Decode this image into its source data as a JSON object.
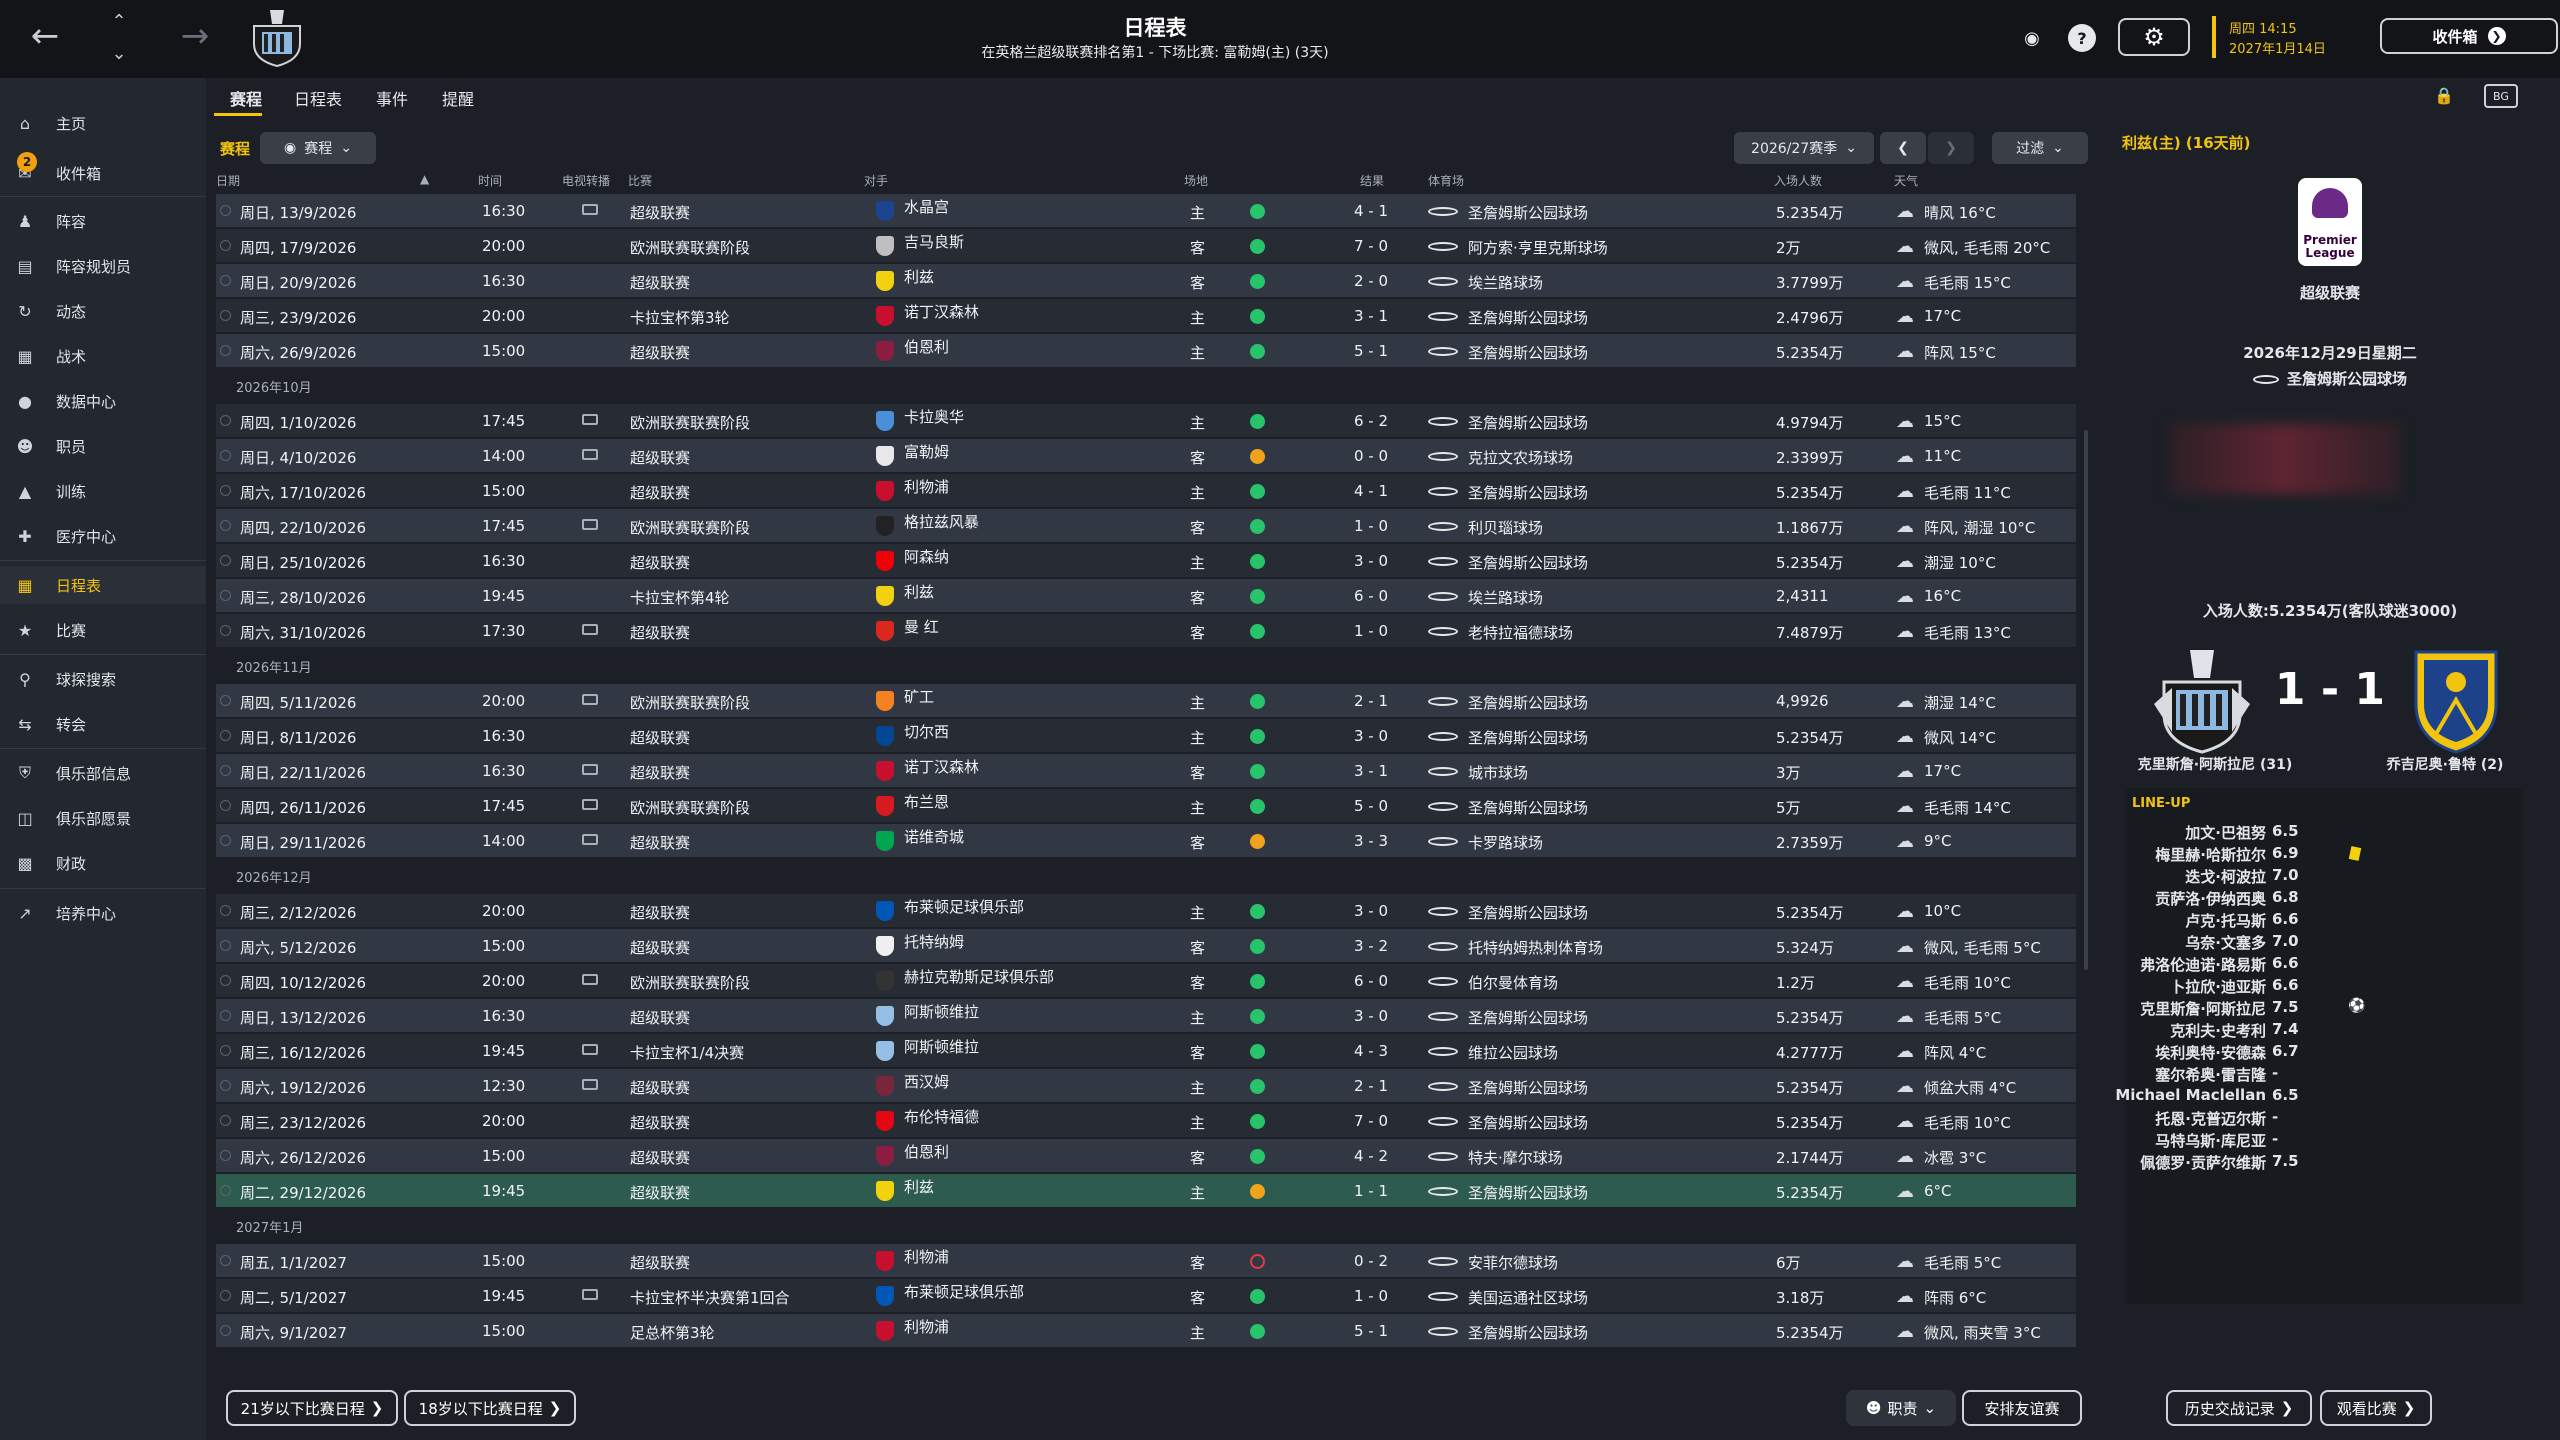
{
  "header": {
    "title": "日程表",
    "subtitle": "在英格兰超级联赛排名第1 - 下场比赛: 富勒姆(主) (3天)",
    "date_line1": "周四 14:15",
    "date_line2": "2027年1月14日",
    "inbox_label": "收件箱"
  },
  "sidebar": {
    "items": [
      {
        "label": "主页",
        "icon": "home-icon"
      },
      {
        "label": "收件箱",
        "icon": "inbox-icon",
        "badge": "2"
      },
      {
        "label": "阵容",
        "icon": "squad-icon"
      },
      {
        "label": "阵容规划员",
        "icon": "planner-icon"
      },
      {
        "label": "动态",
        "icon": "dynamics-icon"
      },
      {
        "label": "战术",
        "icon": "tactics-icon"
      },
      {
        "label": "数据中心",
        "icon": "data-hub-icon"
      },
      {
        "label": "职员",
        "icon": "staff-icon"
      },
      {
        "label": "训练",
        "icon": "training-icon"
      },
      {
        "label": "医疗中心",
        "icon": "medical-icon"
      },
      {
        "label": "日程表",
        "icon": "calendar-icon",
        "active": true
      },
      {
        "label": "比赛",
        "icon": "trophy-icon"
      },
      {
        "label": "球探搜索",
        "icon": "scouting-icon"
      },
      {
        "label": "转会",
        "icon": "transfers-icon"
      },
      {
        "label": "俱乐部信息",
        "icon": "club-info-icon"
      },
      {
        "label": "俱乐部愿景",
        "icon": "club-vision-icon"
      },
      {
        "label": "财政",
        "icon": "finances-icon"
      },
      {
        "label": "培养中心",
        "icon": "development-icon"
      }
    ]
  },
  "subtabs": [
    "赛程",
    "日程表",
    "事件",
    "提醒"
  ],
  "filter": {
    "label": "赛程",
    "view_label": "赛程",
    "season": "2026/27赛季",
    "filter_label": "过滤"
  },
  "columns": {
    "date": "日期",
    "time": "时间",
    "tv": "电视转播",
    "competition": "比赛",
    "opponent": "对手",
    "venue": "场地",
    "result": "结果",
    "stadium": "体育场",
    "attendance": "入场人数",
    "weather": "天气"
  },
  "rows": [
    {
      "date": "周日, 13/9/2026",
      "time": "16:30",
      "tv": true,
      "comp": "超级联赛",
      "opp": "水晶宫",
      "opp_color": "#1b458f",
      "venue": "主",
      "res": "win",
      "score": "4 - 1",
      "stadium": "圣詹姆斯公园球场",
      "att": "5.2354万",
      "weather": "晴风 16°C"
    },
    {
      "date": "周四, 17/9/2026",
      "time": "20:00",
      "tv": false,
      "comp": "欧洲联赛联赛阶段",
      "opp": "吉马良斯",
      "opp_color": "#bfbfbf",
      "venue": "客",
      "res": "win",
      "score": "7 - 0",
      "stadium": "阿方索·亨里克斯球场",
      "att": "2万",
      "weather": "微风, 毛毛雨 20°C"
    },
    {
      "date": "周日, 20/9/2026",
      "time": "16:30",
      "tv": false,
      "comp": "超级联赛",
      "opp": "利兹",
      "opp_color": "#f2d20e",
      "venue": "客",
      "res": "win",
      "score": "2 - 0",
      "stadium": "埃兰路球场",
      "att": "3.7799万",
      "weather": "毛毛雨 15°C"
    },
    {
      "date": "周三, 23/9/2026",
      "time": "20:00",
      "tv": false,
      "comp": "卡拉宝杯第3轮",
      "opp": "诺丁汉森林",
      "opp_color": "#c8102e",
      "venue": "主",
      "res": "win",
      "score": "3 - 1",
      "stadium": "圣詹姆斯公园球场",
      "att": "2.4796万",
      "weather": "17°C"
    },
    {
      "date": "周六, 26/9/2026",
      "time": "15:00",
      "tv": false,
      "comp": "超级联赛",
      "opp": "伯恩利",
      "opp_color": "#8c1d40",
      "venue": "主",
      "res": "win",
      "score": "5 - 1",
      "stadium": "圣詹姆斯公园球场",
      "att": "5.2354万",
      "weather": "阵风 15°C"
    },
    {
      "month": "2026年10月"
    },
    {
      "date": "周四, 1/10/2026",
      "time": "17:45",
      "tv": true,
      "comp": "欧洲联赛联赛阶段",
      "opp": "卡拉奥华",
      "opp_color": "#4a90d9",
      "venue": "主",
      "res": "win",
      "score": "6 - 2",
      "stadium": "圣詹姆斯公园球场",
      "att": "4.9794万",
      "weather": "15°C"
    },
    {
      "date": "周日, 4/10/2026",
      "time": "14:00",
      "tv": true,
      "comp": "超级联赛",
      "opp": "富勒姆",
      "opp_color": "#e8e8e8",
      "venue": "客",
      "res": "draw",
      "score": "0 - 0",
      "stadium": "克拉文农场球场",
      "att": "2.3399万",
      "weather": "11°C"
    },
    {
      "date": "周六, 17/10/2026",
      "time": "15:00",
      "tv": false,
      "comp": "超级联赛",
      "opp": "利物浦",
      "opp_color": "#c8102e",
      "venue": "主",
      "res": "win",
      "score": "4 - 1",
      "stadium": "圣詹姆斯公园球场",
      "att": "5.2354万",
      "weather": "毛毛雨 11°C"
    },
    {
      "date": "周四, 22/10/2026",
      "time": "17:45",
      "tv": true,
      "comp": "欧洲联赛联赛阶段",
      "opp": "格拉兹风暴",
      "opp_color": "#222222",
      "venue": "客",
      "res": "win",
      "score": "1 - 0",
      "stadium": "利贝瑙球场",
      "att": "1.1867万",
      "weather": "阵风, 潮湿 10°C"
    },
    {
      "date": "周日, 25/10/2026",
      "time": "16:30",
      "tv": false,
      "comp": "超级联赛",
      "opp": "阿森纳",
      "opp_color": "#ef0107",
      "venue": "主",
      "res": "win",
      "score": "3 - 0",
      "stadium": "圣詹姆斯公园球场",
      "att": "5.2354万",
      "weather": "潮湿 10°C"
    },
    {
      "date": "周三, 28/10/2026",
      "time": "19:45",
      "tv": false,
      "comp": "卡拉宝杯第4轮",
      "opp": "利兹",
      "opp_color": "#f2d20e",
      "venue": "客",
      "res": "win",
      "score": "6 - 0",
      "stadium": "埃兰路球场",
      "att": "2,4311",
      "weather": "16°C"
    },
    {
      "date": "周六, 31/10/2026",
      "time": "17:30",
      "tv": true,
      "comp": "超级联赛",
      "opp": "曼 红",
      "opp_color": "#da291c",
      "venue": "客",
      "res": "win",
      "score": "1 - 0",
      "stadium": "老特拉福德球场",
      "att": "7.4879万",
      "weather": "毛毛雨 13°C"
    },
    {
      "month": "2026年11月"
    },
    {
      "date": "周四, 5/11/2026",
      "time": "20:00",
      "tv": true,
      "comp": "欧洲联赛联赛阶段",
      "opp": "矿工",
      "opp_color": "#f58220",
      "venue": "主",
      "res": "win",
      "score": "2 - 1",
      "stadium": "圣詹姆斯公园球场",
      "att": "4,9926",
      "weather": "潮湿 14°C"
    },
    {
      "date": "周日, 8/11/2026",
      "time": "16:30",
      "tv": false,
      "comp": "超级联赛",
      "opp": "切尔西",
      "opp_color": "#034694",
      "venue": "主",
      "res": "win",
      "score": "3 - 0",
      "stadium": "圣詹姆斯公园球场",
      "att": "5.2354万",
      "weather": "微风 14°C"
    },
    {
      "date": "周日, 22/11/2026",
      "time": "16:30",
      "tv": true,
      "comp": "超级联赛",
      "opp": "诺丁汉森林",
      "opp_color": "#c8102e",
      "venue": "客",
      "res": "win",
      "score": "3 - 1",
      "stadium": "城市球场",
      "att": "3万",
      "weather": "17°C"
    },
    {
      "date": "周四, 26/11/2026",
      "time": "17:45",
      "tv": true,
      "comp": "欧洲联赛联赛阶段",
      "opp": "布兰恩",
      "opp_color": "#d71920",
      "venue": "主",
      "res": "win",
      "score": "5 - 0",
      "stadium": "圣詹姆斯公园球场",
      "att": "5万",
      "weather": "毛毛雨 14°C"
    },
    {
      "date": "周日, 29/11/2026",
      "time": "14:00",
      "tv": true,
      "comp": "超级联赛",
      "opp": "诺维奇城",
      "opp_color": "#00a650",
      "venue": "客",
      "res": "draw",
      "score": "3 - 3",
      "stadium": "卡罗路球场",
      "att": "2.7359万",
      "weather": "9°C"
    },
    {
      "month": "2026年12月"
    },
    {
      "date": "周三, 2/12/2026",
      "time": "20:00",
      "tv": false,
      "comp": "超级联赛",
      "opp": "布莱顿足球俱乐部",
      "opp_color": "#0057b8",
      "venue": "主",
      "res": "win",
      "score": "3 - 0",
      "stadium": "圣詹姆斯公园球场",
      "att": "5.2354万",
      "weather": "10°C"
    },
    {
      "date": "周六, 5/12/2026",
      "time": "15:00",
      "tv": false,
      "comp": "超级联赛",
      "opp": "托特纳姆",
      "opp_color": "#f0f0f0",
      "venue": "客",
      "res": "win",
      "score": "3 - 2",
      "stadium": "托特纳姆热刺体育场",
      "att": "5.324万",
      "weather": "微风, 毛毛雨 5°C"
    },
    {
      "date": "周四, 10/12/2026",
      "time": "20:00",
      "tv": true,
      "comp": "欧洲联赛联赛阶段",
      "opp": "赫拉克勒斯足球俱乐部",
      "opp_color": "#333333",
      "venue": "客",
      "res": "win",
      "score": "6 - 0",
      "stadium": "伯尔曼体育场",
      "att": "1.2万",
      "weather": "毛毛雨 10°C"
    },
    {
      "date": "周日, 13/12/2026",
      "time": "16:30",
      "tv": false,
      "comp": "超级联赛",
      "opp": "阿斯顿维拉",
      "opp_color": "#95bfe5",
      "venue": "主",
      "res": "win",
      "score": "3 - 0",
      "stadium": "圣詹姆斯公园球场",
      "att": "5.2354万",
      "weather": "毛毛雨 5°C"
    },
    {
      "date": "周三, 16/12/2026",
      "time": "19:45",
      "tv": true,
      "comp": "卡拉宝杯1/4决赛",
      "opp": "阿斯顿维拉",
      "opp_color": "#95bfe5",
      "venue": "客",
      "res": "win",
      "score": "4 - 3",
      "stadium": "维拉公园球场",
      "att": "4.2777万",
      "weather": "阵风 4°C"
    },
    {
      "date": "周六, 19/12/2026",
      "time": "12:30",
      "tv": true,
      "comp": "超级联赛",
      "opp": "西汉姆",
      "opp_color": "#7a263a",
      "venue": "主",
      "res": "win",
      "score": "2 - 1",
      "stadium": "圣詹姆斯公园球场",
      "att": "5.2354万",
      "weather": "倾盆大雨 4°C"
    },
    {
      "date": "周三, 23/12/2026",
      "time": "20:00",
      "tv": false,
      "comp": "超级联赛",
      "opp": "布伦特福德",
      "opp_color": "#e30613",
      "venue": "主",
      "res": "win",
      "score": "7 - 0",
      "stadium": "圣詹姆斯公园球场",
      "att": "5.2354万",
      "weather": "毛毛雨 10°C"
    },
    {
      "date": "周六, 26/12/2026",
      "time": "15:00",
      "tv": false,
      "comp": "超级联赛",
      "opp": "伯恩利",
      "opp_color": "#8c1d40",
      "venue": "客",
      "res": "win",
      "score": "4 - 2",
      "stadium": "特夫·摩尔球场",
      "att": "2.1744万",
      "weather": "冰雹 3°C"
    },
    {
      "date": "周二, 29/12/2026",
      "time": "19:45",
      "tv": false,
      "comp": "超级联赛",
      "opp": "利兹",
      "opp_color": "#f2d20e",
      "venue": "主",
      "res": "draw",
      "score": "1 - 1",
      "stadium": "圣詹姆斯公园球场",
      "att": "5.2354万",
      "weather": "6°C",
      "selected": true
    },
    {
      "month": "2027年1月"
    },
    {
      "date": "周五, 1/1/2027",
      "time": "15:00",
      "tv": false,
      "comp": "超级联赛",
      "opp": "利物浦",
      "opp_color": "#c8102e",
      "venue": "客",
      "res": "loss",
      "score": "0 - 2",
      "stadium": "安菲尔德球场",
      "att": "6万",
      "weather": "毛毛雨 5°C"
    },
    {
      "date": "周二, 5/1/2027",
      "time": "19:45",
      "tv": true,
      "comp": "卡拉宝杯半决赛第1回合",
      "opp": "布莱顿足球俱乐部",
      "opp_color": "#0057b8",
      "venue": "客",
      "res": "win",
      "score": "1 - 0",
      "stadium": "美国运通社区球场",
      "att": "3.18万",
      "weather": "阵雨 6°C"
    },
    {
      "date": "周六, 9/1/2027",
      "time": "15:00",
      "tv": false,
      "comp": "足总杯第3轮",
      "opp": "利物浦",
      "opp_color": "#c8102e",
      "venue": "主",
      "res": "win",
      "score": "5 - 1",
      "stadium": "圣詹姆斯公园球场",
      "att": "5.2354万",
      "weather": "微风, 雨夹雪 3°C"
    }
  ],
  "bottom": {
    "u21_label": "21岁以下比赛日程",
    "u18_label": "18岁以下比赛日程",
    "staff_label": "职责",
    "friendly_label": "安排友谊赛",
    "history_label": "历史交战记录",
    "watch_label": "观看比赛"
  },
  "detail": {
    "heading": "利兹(主) (16天前)",
    "competition": "超级联赛",
    "league_logo_text": "Premier League",
    "date": "2026年12月29日星期二",
    "stadium": "圣詹姆斯公园球场",
    "attendance": "入场人数:5.2354万(客队球迷3000)",
    "score": "1 - 1",
    "home_scorer": "克里斯詹·阿斯拉尼 (31)",
    "away_scorer": "乔吉尼奥·鲁特 (2)",
    "lineup_title": "LINE-UP",
    "lineup": [
      {
        "name": "加文·巴祖努",
        "rating": "6.5"
      },
      {
        "name": "梅里赫·哈斯拉尔",
        "rating": "6.9",
        "card": "yellow"
      },
      {
        "name": "迭戈·柯波拉",
        "rating": "7.0"
      },
      {
        "name": "贡萨洛·伊纳西奥",
        "rating": "6.8"
      },
      {
        "name": "卢克·托马斯",
        "rating": "6.6"
      },
      {
        "name": "乌奈·文塞多",
        "rating": "7.0"
      },
      {
        "name": "弗洛伦迪诺·路易斯",
        "rating": "6.6"
      },
      {
        "name": "卜拉欣·迪亚斯",
        "rating": "6.6"
      },
      {
        "name": "克里斯詹·阿斯拉尼",
        "rating": "7.5",
        "goal": true
      },
      {
        "name": "克利夫·史考利",
        "rating": "7.4"
      },
      {
        "name": "埃利奥特·安德森",
        "rating": "6.7"
      },
      {
        "name": "塞尔希奥·雷吉隆",
        "rating": "-"
      },
      {
        "name": "Michael Maclellan",
        "rating": "6.5"
      },
      {
        "name": "托恩·克普迈尔斯",
        "rating": "-"
      },
      {
        "name": "马特乌斯·库尼亚",
        "rating": "-"
      },
      {
        "name": "佩德罗·贡萨尔维斯",
        "rating": "7.5"
      }
    ]
  },
  "colors": {
    "accent": "#f2c40e",
    "win": "#27c46b",
    "draw": "#f0a31b",
    "loss": "#e53945",
    "selected_row": "#2d5b4e"
  }
}
